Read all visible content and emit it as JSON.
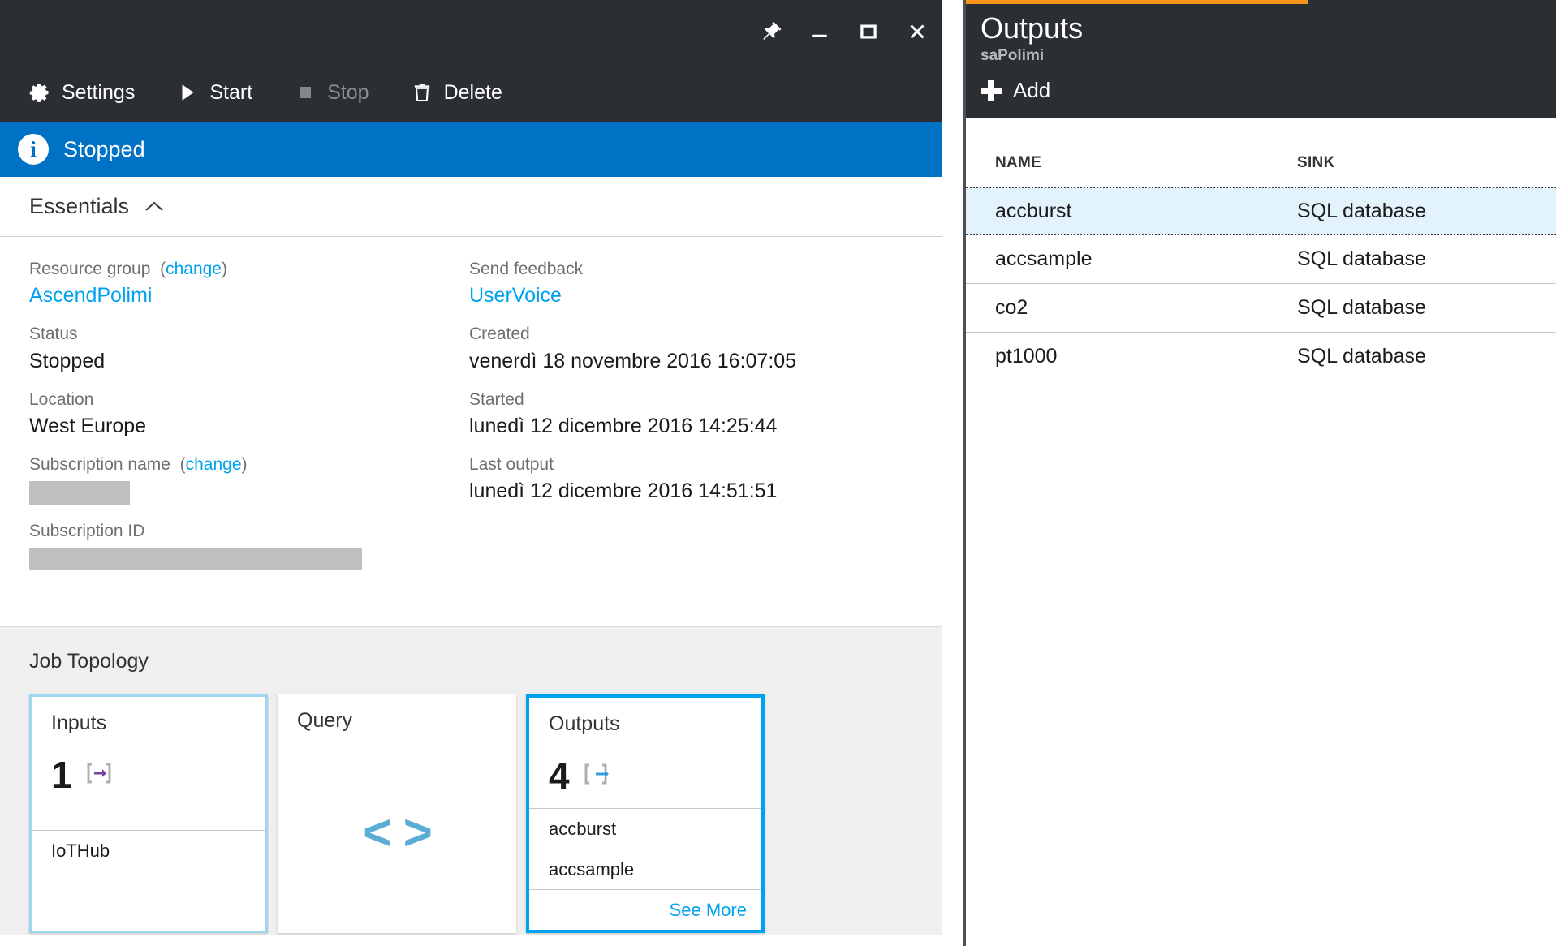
{
  "window_controls": [
    {
      "name": "pin-icon",
      "label": "Pin"
    },
    {
      "name": "minimize-icon",
      "label": "Minimize"
    },
    {
      "name": "maximize-icon",
      "label": "Maximize"
    },
    {
      "name": "close-icon",
      "label": "Close"
    }
  ],
  "toolbar": {
    "items": [
      {
        "label": "Settings",
        "icon": "gear-icon",
        "disabled": false
      },
      {
        "label": "Start",
        "icon": "play-icon",
        "disabled": false
      },
      {
        "label": "Stop",
        "icon": "stop-square-icon",
        "disabled": true
      },
      {
        "label": "Delete",
        "icon": "trash-icon",
        "disabled": false
      }
    ]
  },
  "status_bar": {
    "icon": "info-icon",
    "text": "Stopped",
    "background": "#0072c6"
  },
  "essentials": {
    "title": "Essentials",
    "collapse_icon": "chevron-up-icon",
    "left_column": [
      {
        "label": "Resource group",
        "link_suffix": "change",
        "value": "AscendPolimi",
        "value_is_link": true
      },
      {
        "label": "Status",
        "value": "Stopped",
        "value_is_link": false
      },
      {
        "label": "Location",
        "value": "West Europe",
        "value_is_link": false
      },
      {
        "label": "Subscription name",
        "link_suffix": "change",
        "value": "",
        "redacted": "sub-name"
      },
      {
        "label": "Subscription ID",
        "value": "",
        "redacted": "sub-id"
      }
    ],
    "right_column": [
      {
        "label": "Send feedback",
        "value": "UserVoice",
        "value_is_link": true
      },
      {
        "label": "Created",
        "value": "venerdì 18 novembre 2016 16:07:05",
        "value_is_link": false
      },
      {
        "label": "Started",
        "value": "lunedì 12 dicembre 2016 14:25:44",
        "value_is_link": false
      },
      {
        "label": "Last output",
        "value": "lunedì 12 dicembre 2016 14:51:51",
        "value_is_link": false
      }
    ]
  },
  "job_topology": {
    "title": "Job Topology",
    "tiles": {
      "inputs": {
        "header": "Inputs",
        "count": "1",
        "icon": "input-arrow-icon",
        "rows": [
          "IoTHub"
        ]
      },
      "query": {
        "header": "Query",
        "icon": "code-brackets-icon",
        "glyph": "< >"
      },
      "outputs": {
        "header": "Outputs",
        "count": "4",
        "icon": "output-arrow-icon",
        "rows": [
          "accburst",
          "accsample"
        ],
        "see_more": "See More"
      }
    }
  },
  "scrollbar": {
    "up_icon": "chevron-up-icon"
  },
  "outputs_blade": {
    "title": "Outputs",
    "subtitle": "saPolimi",
    "accent_color": "#f7941e",
    "add_button": {
      "label": "Add",
      "icon": "plus-icon"
    },
    "table": {
      "columns": [
        "NAME",
        "SINK"
      ],
      "rows": [
        {
          "name": "accburst",
          "sink": "SQL database",
          "selected": true
        },
        {
          "name": "accsample",
          "sink": "SQL database",
          "selected": false
        },
        {
          "name": "co2",
          "sink": "SQL database",
          "selected": false
        },
        {
          "name": "pt1000",
          "sink": "SQL database",
          "selected": false
        }
      ]
    }
  }
}
